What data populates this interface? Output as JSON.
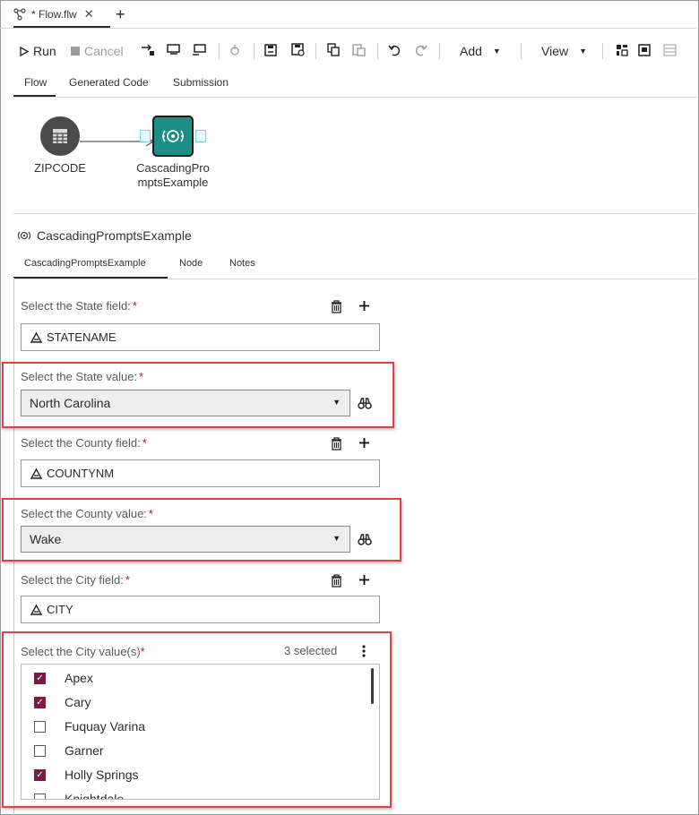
{
  "tab": {
    "title": "* Flow.flw",
    "close": "✕",
    "add": "+"
  },
  "toolbar": {
    "run": "Run",
    "cancel": "Cancel",
    "add": "Add",
    "view": "View",
    "icons": [
      "run-icon",
      "cancel-icon",
      "step-in-icon",
      "step-over-icon",
      "step-out-icon",
      "pin-icon",
      "save-icon",
      "save-as-icon",
      "copy-icon",
      "paste-icon",
      "undo-icon",
      "redo-icon",
      "layout-icon",
      "panel-icon",
      "properties-icon"
    ]
  },
  "flow_tabs": [
    "Flow",
    "Generated Code",
    "Submission"
  ],
  "nodes": {
    "zipcode": {
      "label": "ZIPCODE",
      "color": "#4a4a4a"
    },
    "cascading": {
      "label_line1": "CascadingPro",
      "label_line2": "mptsExample",
      "color": "#1b8f86"
    }
  },
  "panel": {
    "title": "CascadingPromptsExample",
    "tabs": [
      "CascadingPromptsExample",
      "Node",
      "Notes"
    ]
  },
  "fields": {
    "state_field": {
      "label": "Select the State field:",
      "required": "*",
      "value": "STATENAME"
    },
    "state_value": {
      "label": "Select the State value:",
      "required": "*",
      "value": "North Carolina"
    },
    "county_field": {
      "label": "Select the County field:",
      "required": "*",
      "value": "COUNTYNM"
    },
    "county_value": {
      "label": "Select the County value:",
      "required": "*",
      "value": "Wake"
    },
    "city_field": {
      "label": "Select the City field:",
      "required": "*",
      "value": "CITY"
    },
    "city_values": {
      "label": "Select the City value(s)",
      "required": "*",
      "selected_text": "3 selected",
      "items": [
        {
          "label": "Apex",
          "checked": true
        },
        {
          "label": "Cary",
          "checked": true
        },
        {
          "label": "Fuquay Varina",
          "checked": false
        },
        {
          "label": "Garner",
          "checked": false
        },
        {
          "label": "Holly Springs",
          "checked": true
        },
        {
          "label": "Knightdale",
          "checked": false
        }
      ]
    }
  },
  "colors": {
    "accent_checkbox": "#7a1b46",
    "highlight": "#e53f3f",
    "required": "#c8102e",
    "node_teal": "#1b8f86"
  }
}
